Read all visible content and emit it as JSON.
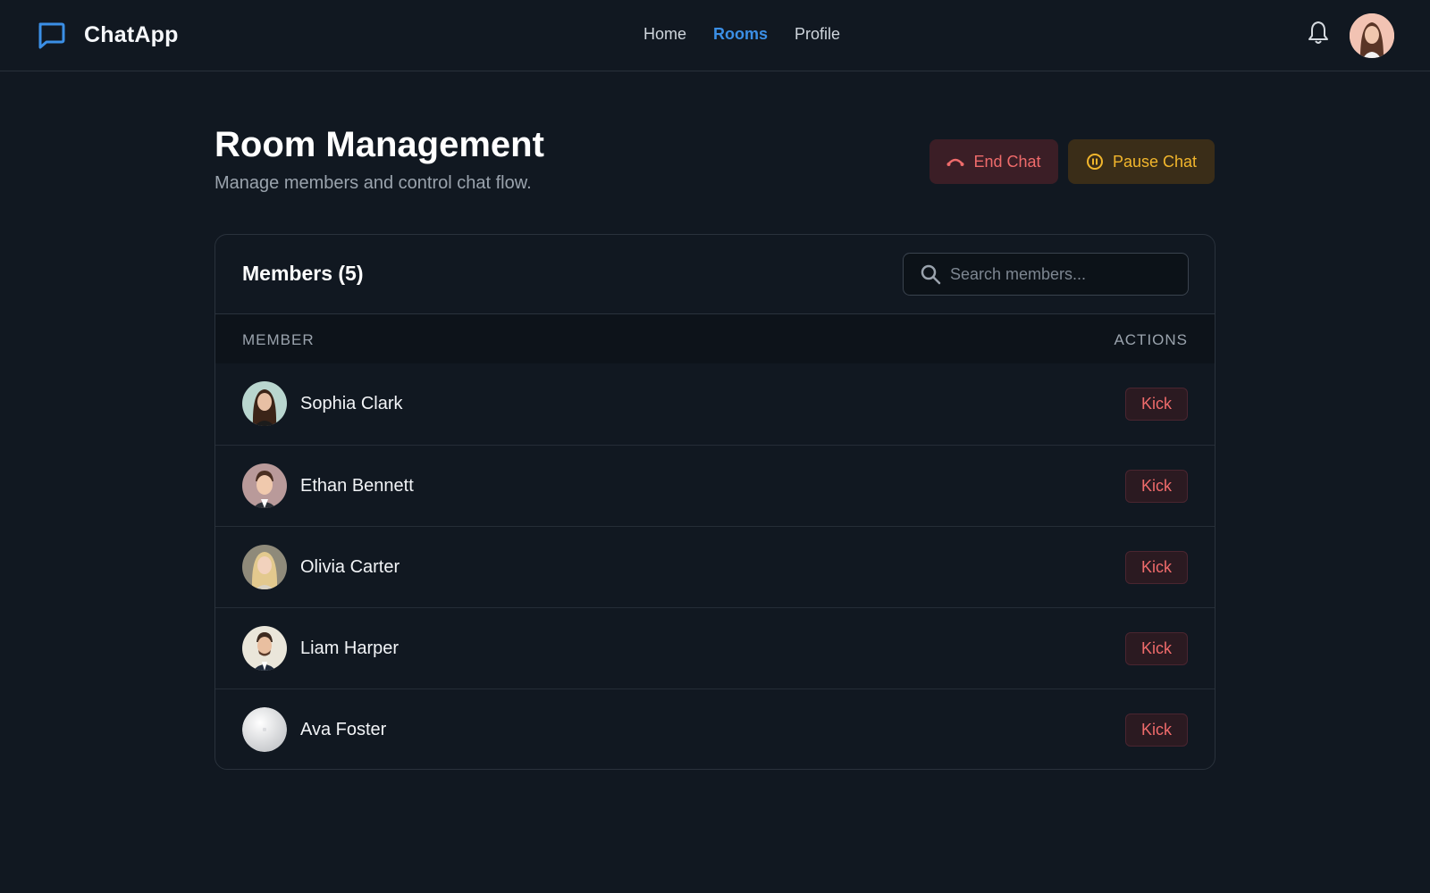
{
  "app": {
    "name": "ChatApp"
  },
  "nav": {
    "items": [
      {
        "label": "Home",
        "active": false
      },
      {
        "label": "Rooms",
        "active": true
      },
      {
        "label": "Profile",
        "active": false
      }
    ]
  },
  "header_icons": {
    "notification": "bell-icon",
    "avatar": "user-avatar"
  },
  "page": {
    "title": "Room Management",
    "subtitle": "Manage members and control chat flow."
  },
  "actions": {
    "end_chat_label": "End Chat",
    "pause_chat_label": "Pause Chat"
  },
  "members": {
    "title": "Members (5)",
    "search_placeholder": "Search members...",
    "columns": {
      "member": "MEMBER",
      "actions": "ACTIONS"
    },
    "list": [
      {
        "name": "Sophia Clark",
        "action": "Kick"
      },
      {
        "name": "Ethan Bennett",
        "action": "Kick"
      },
      {
        "name": "Olivia Carter",
        "action": "Kick"
      },
      {
        "name": "Liam Harper",
        "action": "Kick"
      },
      {
        "name": "Ava Foster",
        "action": "Kick"
      }
    ]
  },
  "colors": {
    "background": "#111821",
    "accent": "#3b8fe6",
    "danger": "#ef6b6b",
    "warning": "#f2b62c"
  }
}
